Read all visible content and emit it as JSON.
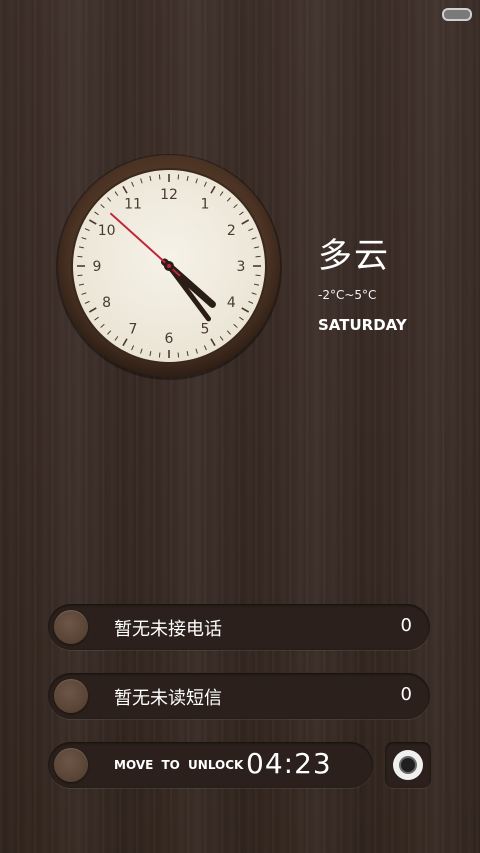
{
  "status_bar": {
    "battery_icon": "battery-icon"
  },
  "clock": {
    "time": "04:23",
    "numerals": [
      "12",
      "1",
      "2",
      "3",
      "4",
      "5",
      "6",
      "7",
      "8",
      "9",
      "10",
      "11"
    ],
    "seconds": 52,
    "colors": {
      "face": "#f3efe3",
      "rim": "#4a3426",
      "second_hand": "#c0253a",
      "hands": "#2a1d16"
    }
  },
  "weather": {
    "condition": "多云",
    "temperature": "-2°C~5°C",
    "day": "SATURDAY"
  },
  "notifications": {
    "calls_label": "暂无未接电话",
    "calls_count": "0",
    "sms_label": "暂无未读短信",
    "sms_count": "0"
  },
  "unlock": {
    "label": "MOVE TO UNLOCK",
    "time": "04:23"
  },
  "camera": {
    "icon": "camera-icon"
  }
}
